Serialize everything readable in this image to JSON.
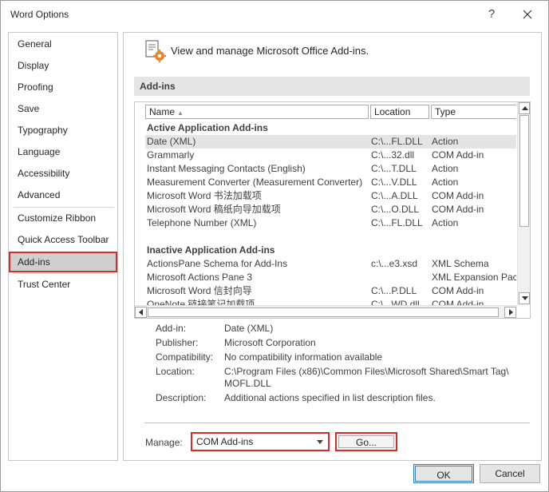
{
  "window": {
    "title": "Word Options",
    "help_label": "?"
  },
  "nav": {
    "items": [
      {
        "label": "General"
      },
      {
        "label": "Display"
      },
      {
        "label": "Proofing"
      },
      {
        "label": "Save"
      },
      {
        "label": "Typography"
      },
      {
        "label": "Language"
      },
      {
        "label": "Accessibility"
      },
      {
        "label": "Advanced"
      },
      {
        "label": "Customize Ribbon"
      },
      {
        "label": "Quick Access Toolbar"
      },
      {
        "label": "Add-ins"
      },
      {
        "label": "Trust Center"
      }
    ],
    "selected": "Add-ins"
  },
  "header": {
    "text": "View and manage Microsoft Office Add-ins."
  },
  "section": {
    "title": "Add-ins"
  },
  "list": {
    "columns": [
      "Name",
      "Location",
      "Type"
    ],
    "sort_indicator": "▲",
    "active_group": "Active Application Add-ins",
    "active_rows": [
      {
        "name": "Date (XML)",
        "location": "C:\\...FL.DLL",
        "type": "Action"
      },
      {
        "name": "Grammarly",
        "location": "C:\\...32.dll",
        "type": "COM Add-in"
      },
      {
        "name": "Instant Messaging Contacts (English)",
        "location": "C:\\...T.DLL",
        "type": "Action"
      },
      {
        "name": "Measurement Converter (Measurement Converter)",
        "location": "C:\\...V.DLL",
        "type": "Action"
      },
      {
        "name": "Microsoft Word 书法加载项",
        "location": "C:\\...A.DLL",
        "type": "COM Add-in"
      },
      {
        "name": "Microsoft Word 稿纸向导加载项",
        "location": "C:\\...O.DLL",
        "type": "COM Add-in"
      },
      {
        "name": "Telephone Number (XML)",
        "location": "C:\\...FL.DLL",
        "type": "Action"
      }
    ],
    "inactive_group": "Inactive Application Add-ins",
    "inactive_rows": [
      {
        "name": "ActionsPane Schema for Add-Ins",
        "location": "c:\\...e3.xsd",
        "type": "XML Schema"
      },
      {
        "name": "Microsoft Actions Pane 3",
        "location": "",
        "type": "XML Expansion Pack"
      },
      {
        "name": "Microsoft Word 信封向导",
        "location": "C:\\...P.DLL",
        "type": "COM Add-in"
      },
      {
        "name": "OneNote 链接笔记加载项",
        "location": "C:\\...WD.dll",
        "type": "COM Add-in"
      }
    ]
  },
  "details": {
    "addin_label": "Add-in:",
    "addin_value": "Date (XML)",
    "publisher_label": "Publisher:",
    "publisher_value": "Microsoft Corporation",
    "compat_label": "Compatibility:",
    "compat_value": "No compatibility information available",
    "location_label": "Location:",
    "location_value_1": "C:\\Program Files (x86)\\Common Files\\Microsoft Shared\\Smart Tag\\",
    "location_value_2": "MOFL.DLL",
    "desc_label": "Description:",
    "desc_value": "Additional actions specified in list description files."
  },
  "manage": {
    "label": "Manage:",
    "selected": "COM Add-ins",
    "go_label": "Go..."
  },
  "footer": {
    "ok_label": "OK",
    "cancel_label": "Cancel"
  },
  "colors": {
    "highlight_border": "#d12f2f",
    "selected_bg": "#cfcfcf",
    "section_bg": "#e5e5e5"
  }
}
